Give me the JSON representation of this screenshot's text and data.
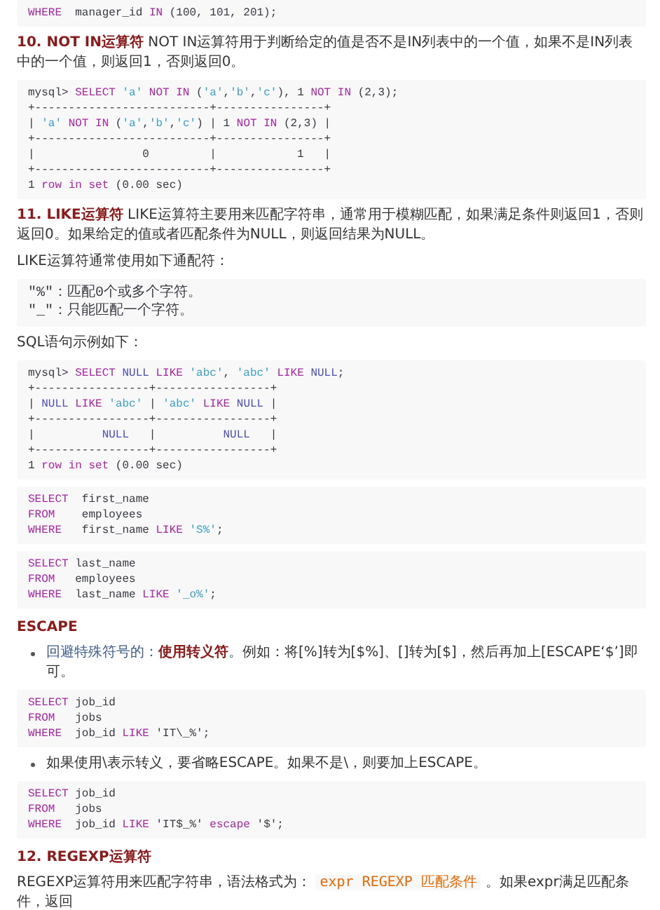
{
  "blocks": [
    {
      "kind": "code",
      "lines": [
        [
          {
            "kind": "kw",
            "text": "WHERE"
          },
          {
            "kind": "plain",
            "text": "  manager_id "
          },
          {
            "kind": "kw",
            "text": "IN"
          },
          {
            "kind": "plain",
            "text": " (100, 101, 201);"
          }
        ]
      ]
    },
    {
      "kind": "para",
      "parts": [
        {
          "kind": "lead",
          "text": "10. NOT IN运算符"
        },
        {
          "kind": "plain",
          "text": " NOT IN运算符用于判断给定的值是否不是IN列表中的一个值，如果不是IN列表中的一个值，则返回1，否则返回0。"
        }
      ]
    },
    {
      "kind": "code",
      "lines": [
        [
          {
            "kind": "plain",
            "text": "mysql> "
          },
          {
            "kind": "kw",
            "text": "SELECT "
          },
          {
            "kind": "str",
            "text": "'a'"
          },
          {
            "kind": "kw",
            "text": " NOT IN"
          },
          {
            "kind": "plain",
            "text": " ("
          },
          {
            "kind": "str",
            "text": "'a'"
          },
          {
            "kind": "plain",
            "text": ","
          },
          {
            "kind": "str",
            "text": "'b'"
          },
          {
            "kind": "plain",
            "text": ","
          },
          {
            "kind": "str",
            "text": "'c'"
          },
          {
            "kind": "plain",
            "text": "), 1 "
          },
          {
            "kind": "kw",
            "text": "NOT IN"
          },
          {
            "kind": "plain",
            "text": " (2,3);"
          }
        ],
        [
          {
            "kind": "plain",
            "text": "+--------------------------+----------------+"
          }
        ],
        [
          {
            "kind": "plain",
            "text": "| "
          },
          {
            "kind": "str",
            "text": "'a'"
          },
          {
            "kind": "kw",
            "text": " NOT IN"
          },
          {
            "kind": "plain",
            "text": " ("
          },
          {
            "kind": "str",
            "text": "'a'"
          },
          {
            "kind": "plain",
            "text": ","
          },
          {
            "kind": "str",
            "text": "'b'"
          },
          {
            "kind": "plain",
            "text": ","
          },
          {
            "kind": "str",
            "text": "'c'"
          },
          {
            "kind": "plain",
            "text": ") | 1 "
          },
          {
            "kind": "kw",
            "text": "NOT IN"
          },
          {
            "kind": "plain",
            "text": " (2,3) |"
          }
        ],
        [
          {
            "kind": "plain",
            "text": "+--------------------------+----------------+"
          }
        ],
        [
          {
            "kind": "plain",
            "text": "|                0         |            1   |"
          }
        ],
        [
          {
            "kind": "plain",
            "text": "+--------------------------+----------------+"
          }
        ],
        [
          {
            "kind": "plain",
            "text": "1 "
          },
          {
            "kind": "kw",
            "text": "row in set"
          },
          {
            "kind": "plain",
            "text": " (0.00 sec)"
          }
        ]
      ]
    },
    {
      "kind": "para",
      "parts": [
        {
          "kind": "lead",
          "text": "11. LIKE运算符"
        },
        {
          "kind": "plain",
          "text": " LIKE运算符主要用来匹配字符串，通常用于模糊匹配，如果满足条件则返回1，否则返回0。如果给定的值或者匹配条件为NULL，则返回结果为NULL。"
        }
      ]
    },
    {
      "kind": "para",
      "parts": [
        {
          "kind": "plain",
          "text": "LIKE运算符通常使用如下通配符："
        }
      ]
    },
    {
      "kind": "note",
      "lines": [
        "\"%\"：匹配0个或多个字符。",
        "\"_\"：只能匹配一个字符。"
      ]
    },
    {
      "kind": "para",
      "parts": [
        {
          "kind": "plain",
          "text": "SQL语句示例如下："
        }
      ]
    },
    {
      "kind": "code",
      "lines": [
        [
          {
            "kind": "plain",
            "text": "mysql> "
          },
          {
            "kind": "kw",
            "text": "SELECT "
          },
          {
            "kind": "lit",
            "text": "NULL "
          },
          {
            "kind": "kw",
            "text": "LIKE "
          },
          {
            "kind": "str",
            "text": "'abc'"
          },
          {
            "kind": "plain",
            "text": ", "
          },
          {
            "kind": "str",
            "text": "'abc' "
          },
          {
            "kind": "kw",
            "text": "LIKE "
          },
          {
            "kind": "lit",
            "text": "NULL"
          },
          {
            "kind": "plain",
            "text": ";"
          }
        ],
        [
          {
            "kind": "plain",
            "text": "+-----------------+-----------------+"
          }
        ],
        [
          {
            "kind": "plain",
            "text": "| "
          },
          {
            "kind": "lit",
            "text": "NULL "
          },
          {
            "kind": "kw",
            "text": "LIKE "
          },
          {
            "kind": "str",
            "text": "'abc'"
          },
          {
            "kind": "plain",
            "text": " | "
          },
          {
            "kind": "str",
            "text": "'abc' "
          },
          {
            "kind": "kw",
            "text": "LIKE "
          },
          {
            "kind": "lit",
            "text": "NULL"
          },
          {
            "kind": "plain",
            "text": " |"
          }
        ],
        [
          {
            "kind": "plain",
            "text": "+-----------------+-----------------+"
          }
        ],
        [
          {
            "kind": "plain",
            "text": "|          "
          },
          {
            "kind": "lit",
            "text": "NULL"
          },
          {
            "kind": "plain",
            "text": "   |          "
          },
          {
            "kind": "lit",
            "text": "NULL"
          },
          {
            "kind": "plain",
            "text": "   |"
          }
        ],
        [
          {
            "kind": "plain",
            "text": "+-----------------+-----------------+"
          }
        ],
        [
          {
            "kind": "plain",
            "text": "1 "
          },
          {
            "kind": "kw",
            "text": "row in set"
          },
          {
            "kind": "plain",
            "text": " (0.00 sec)"
          }
        ]
      ]
    },
    {
      "kind": "code",
      "lines": [
        [
          {
            "kind": "kw",
            "text": "SELECT"
          },
          {
            "kind": "plain",
            "text": "  first_name"
          }
        ],
        [
          {
            "kind": "kw",
            "text": "FROM"
          },
          {
            "kind": "plain",
            "text": "    employees"
          }
        ],
        [
          {
            "kind": "kw",
            "text": "WHERE"
          },
          {
            "kind": "plain",
            "text": "   first_name "
          },
          {
            "kind": "kw",
            "text": "LIKE "
          },
          {
            "kind": "str",
            "text": "'S%'"
          },
          {
            "kind": "plain",
            "text": ";"
          }
        ]
      ]
    },
    {
      "kind": "code",
      "lines": [
        [
          {
            "kind": "kw",
            "text": "SELECT"
          },
          {
            "kind": "plain",
            "text": " last_name"
          }
        ],
        [
          {
            "kind": "kw",
            "text": "FROM"
          },
          {
            "kind": "plain",
            "text": "   employees"
          }
        ],
        [
          {
            "kind": "kw",
            "text": "WHERE"
          },
          {
            "kind": "plain",
            "text": "  last_name "
          },
          {
            "kind": "kw",
            "text": "LIKE "
          },
          {
            "kind": "str",
            "text": "'_o%'"
          },
          {
            "kind": "plain",
            "text": ";"
          }
        ]
      ]
    },
    {
      "kind": "heading",
      "text": "ESCAPE"
    },
    {
      "kind": "bullet",
      "parts": [
        {
          "kind": "blue",
          "text": "回避特殊符号的："
        },
        {
          "kind": "lead",
          "text": "使用转义符"
        },
        {
          "kind": "plain",
          "text": "。例如：将[%]转为[$%]、[]转为[$]，然后再加上[ESCAPE‘$’]即可。"
        }
      ]
    },
    {
      "kind": "code",
      "lines": [
        [
          {
            "kind": "kw",
            "text": "SELECT"
          },
          {
            "kind": "plain",
            "text": " job_id"
          }
        ],
        [
          {
            "kind": "kw",
            "text": "FROM"
          },
          {
            "kind": "plain",
            "text": "   jobs"
          }
        ],
        [
          {
            "kind": "kw",
            "text": "WHERE"
          },
          {
            "kind": "plain",
            "text": "  job_id "
          },
          {
            "kind": "kw",
            "text": "LIKE"
          },
          {
            "kind": "plain",
            "text": " 'IT\\_%';"
          }
        ]
      ]
    },
    {
      "kind": "bullet",
      "parts": [
        {
          "kind": "plain",
          "text": "如果使用\\表示转义，要省略ESCAPE。如果不是\\，则要加上ESCAPE。"
        }
      ]
    },
    {
      "kind": "code",
      "lines": [
        [
          {
            "kind": "kw",
            "text": "SELECT"
          },
          {
            "kind": "plain",
            "text": " job_id"
          }
        ],
        [
          {
            "kind": "kw",
            "text": "FROM"
          },
          {
            "kind": "plain",
            "text": "   jobs"
          }
        ],
        [
          {
            "kind": "kw",
            "text": "WHERE"
          },
          {
            "kind": "plain",
            "text": "  job_id "
          },
          {
            "kind": "kw",
            "text": "LIKE"
          },
          {
            "kind": "plain",
            "text": " 'IT$_%' "
          },
          {
            "kind": "kw",
            "text": "escape"
          },
          {
            "kind": "plain",
            "text": " '$';"
          }
        ]
      ]
    },
    {
      "kind": "heading",
      "text": "12. REGEXP运算符"
    },
    {
      "kind": "para",
      "parts": [
        {
          "kind": "plain",
          "text": "REGEXP运算符用来匹配字符串，语法格式为："
        },
        {
          "kind": "code",
          "text": "expr REGEXP 匹配条件"
        },
        {
          "kind": "plain",
          "text": "。如果expr满足匹配条件，返回"
        }
      ]
    }
  ]
}
